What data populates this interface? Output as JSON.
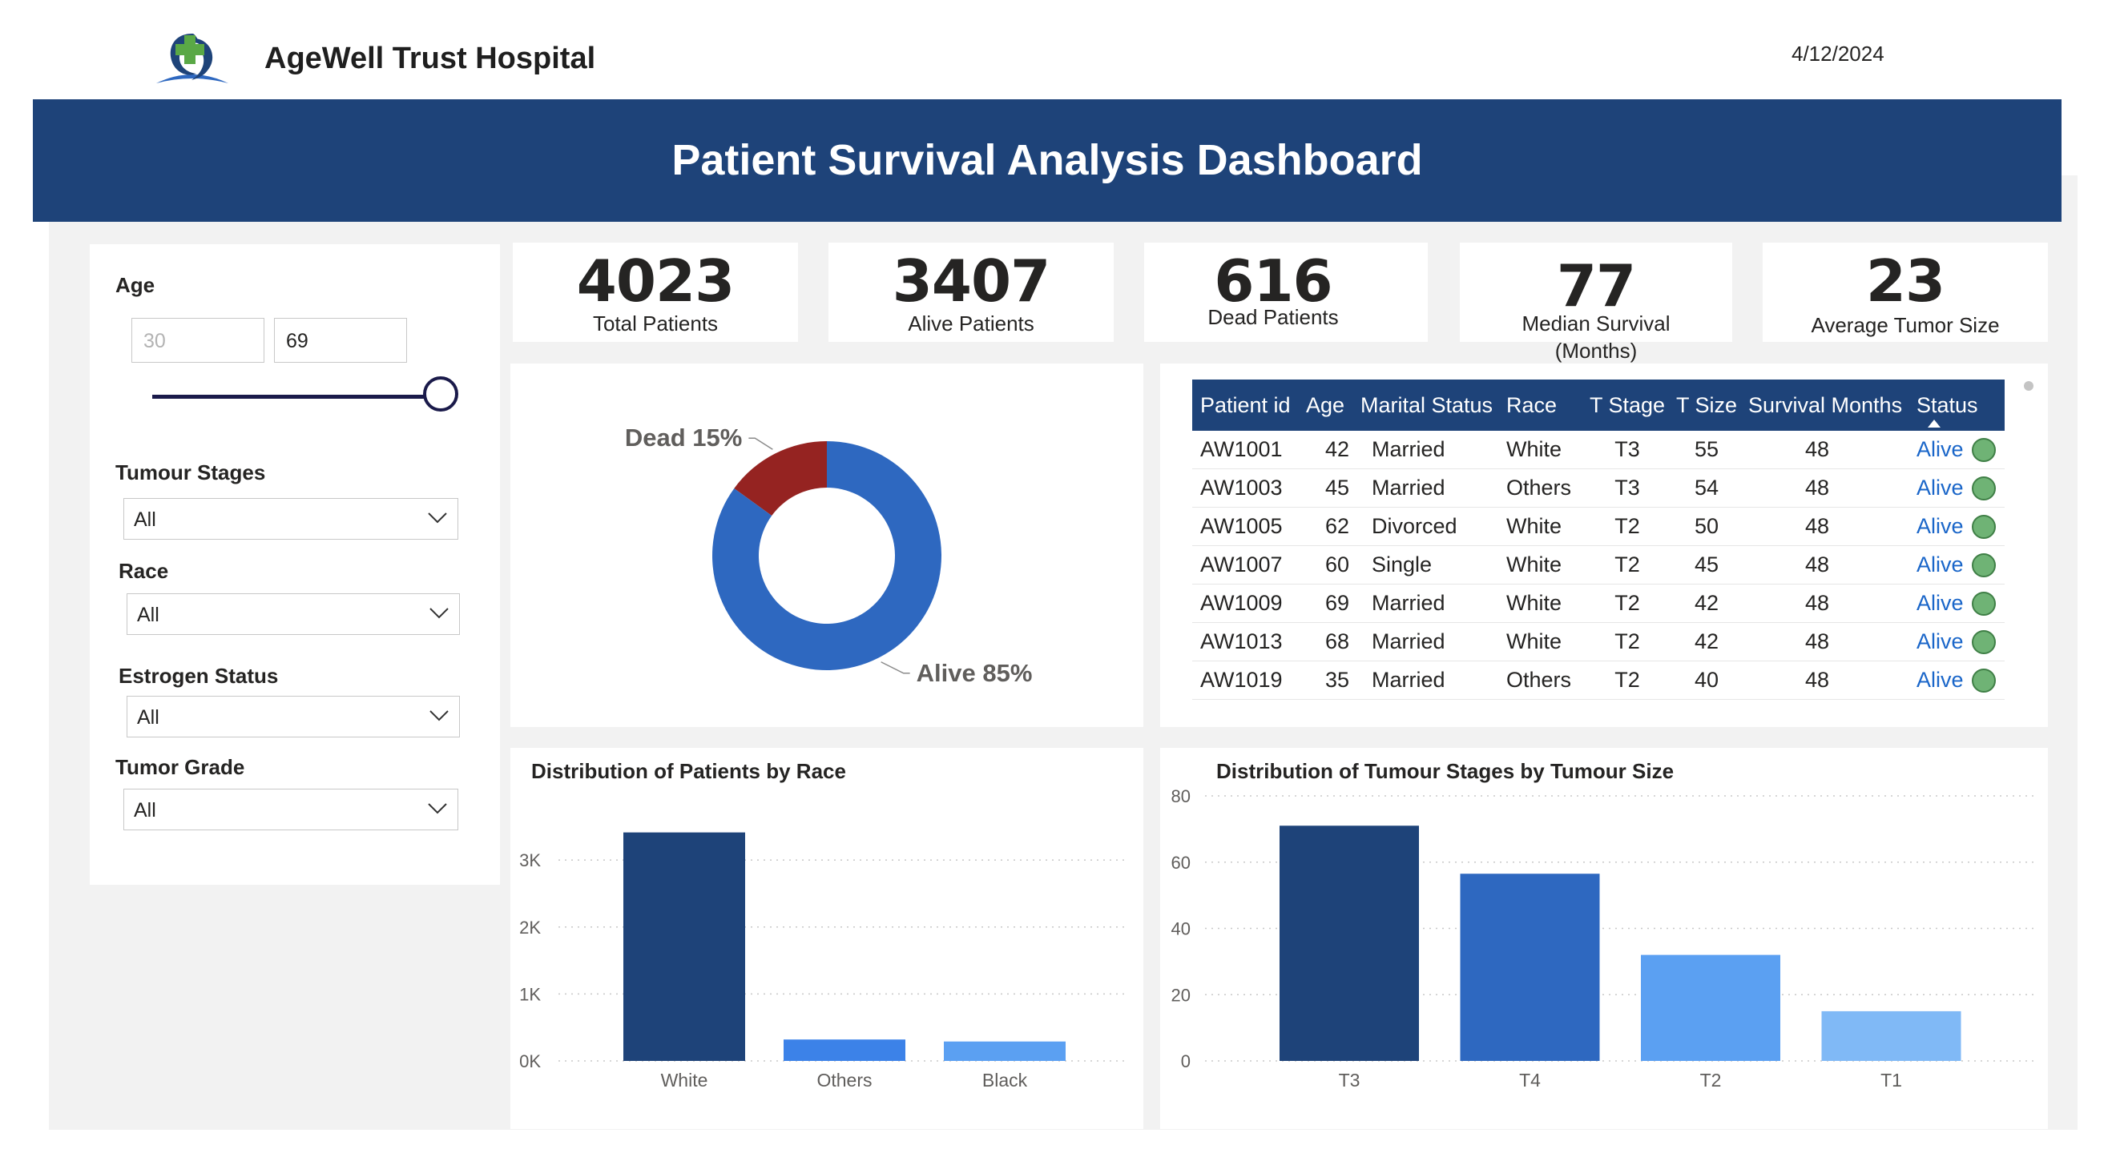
{
  "header": {
    "hospital_name": "AgeWell Trust Hospital",
    "date": "4/12/2024",
    "dashboard_title": "Patient Survival Analysis Dashboard",
    "logo_icon": "hospital-cross-ribbon-logo"
  },
  "colors": {
    "banner": "#1e4379",
    "dead": "#952321",
    "alive": "#2e68c0",
    "status_ok": "#6fb375"
  },
  "filters": {
    "age": {
      "title": "Age",
      "min": "30",
      "max": "69",
      "slider_position": 1.0
    },
    "tumour_stages": {
      "title": "Tumour Stages",
      "value": "All"
    },
    "race": {
      "title": "Race",
      "value": "All"
    },
    "estrogen_status": {
      "title": "Estrogen Status",
      "value": "All"
    },
    "tumor_grade": {
      "title": "Tumor Grade",
      "value": "All"
    }
  },
  "kpis": [
    {
      "value": "4023",
      "label": "Total Patients"
    },
    {
      "value": "3407",
      "label": "Alive Patients"
    },
    {
      "value": "616",
      "label": "Dead Patients"
    },
    {
      "value": "77",
      "label": "Median Survival",
      "label2": "(Months)"
    },
    {
      "value": "23",
      "label": "Average Tumor Size"
    }
  ],
  "table": {
    "columns": [
      "Patient id",
      "Age",
      "Marital Status",
      "Race",
      "T Stage",
      "T Size",
      "Survival Months",
      "Status"
    ],
    "sort_icon": "sort-ascending-icon",
    "rows": [
      [
        "AW1001",
        "42",
        "Married",
        "White",
        "T3",
        "55",
        "48",
        "Alive"
      ],
      [
        "AW1003",
        "45",
        "Married",
        "Others",
        "T3",
        "54",
        "48",
        "Alive"
      ],
      [
        "AW1005",
        "62",
        "Divorced",
        "White",
        "T2",
        "50",
        "48",
        "Alive"
      ],
      [
        "AW1007",
        "60",
        "Single",
        "White",
        "T2",
        "45",
        "48",
        "Alive"
      ],
      [
        "AW1009",
        "69",
        "Married",
        "White",
        "T2",
        "42",
        "48",
        "Alive"
      ],
      [
        "AW1013",
        "68",
        "Married",
        "White",
        "T2",
        "42",
        "48",
        "Alive"
      ],
      [
        "AW1019",
        "35",
        "Married",
        "Others",
        "T2",
        "40",
        "48",
        "Alive"
      ]
    ]
  },
  "chart_data": [
    {
      "type": "pie",
      "title": "",
      "donut": true,
      "slices": [
        {
          "label": "Dead",
          "value": 15,
          "display": "Dead 15%",
          "color": "#952321"
        },
        {
          "label": "Alive",
          "value": 85,
          "display": "Alive 85%",
          "color": "#2e68c0"
        }
      ]
    },
    {
      "type": "bar",
      "title": "Distribution of Patients by Race",
      "categories": [
        "White",
        "Others",
        "Black"
      ],
      "values": [
        3413,
        320,
        290
      ],
      "colors": [
        "#1e4379",
        "#3c82e8",
        "#5ba0f2"
      ],
      "yticks": [
        "0K",
        "1K",
        "2K",
        "3K"
      ],
      "ytick_values": [
        0,
        1000,
        2000,
        3000
      ],
      "ylim": [
        0,
        3600
      ],
      "grid": true
    },
    {
      "type": "bar",
      "title": "Distribution of Tumour Stages by Tumour Size",
      "categories": [
        "T3",
        "T4",
        "T2",
        "T1"
      ],
      "values": [
        71,
        56.5,
        32,
        15
      ],
      "colors": [
        "#1e4379",
        "#2e68c0",
        "#5ba0f2",
        "#80b9f6"
      ],
      "yticks": [
        "0",
        "20",
        "40",
        "60",
        "80"
      ],
      "ytick_values": [
        0,
        20,
        40,
        60,
        80
      ],
      "ylim": [
        0,
        80
      ],
      "grid": true
    }
  ]
}
